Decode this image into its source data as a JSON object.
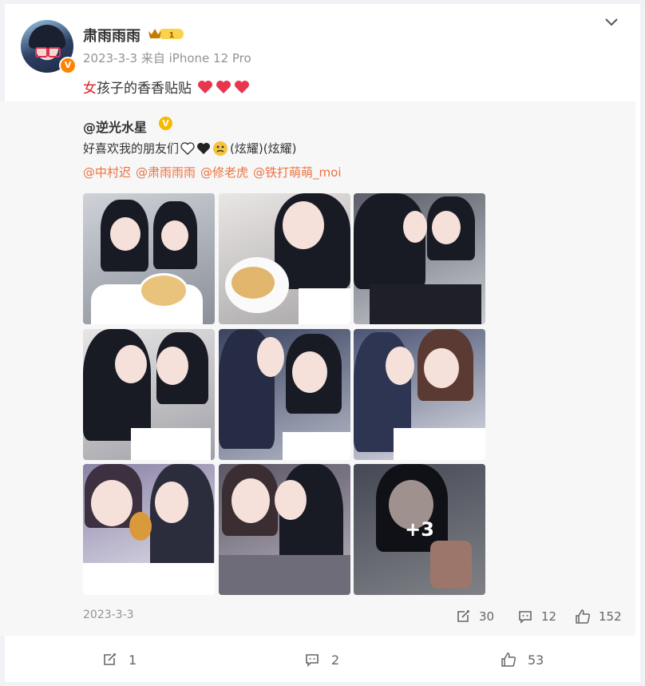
{
  "post": {
    "author": "肃雨雨雨",
    "level_badge": "1",
    "verified_badge": "V",
    "date": "2023-3-3",
    "source": "来自 iPhone 12 Pro",
    "text_highlight": "女",
    "text_rest": "孩子的香香贴贴"
  },
  "repost": {
    "author": "@逆光水星",
    "verified_badge": "V",
    "text_start": "好喜欢我的朋友们",
    "text_tail": "(炫耀)(炫耀)",
    "mentions": [
      "@中村迟",
      "@肃雨雨雨",
      "@修老虎",
      "@铁打萌萌_moi"
    ],
    "more_label": "+3",
    "date": "2023-3-3",
    "stats": {
      "shares": "30",
      "comments": "12",
      "likes": "152"
    }
  },
  "footer": {
    "shares": "1",
    "comments": "2",
    "likes": "53"
  },
  "colors": {
    "mention": "#eb7340",
    "highlight": "#e02020",
    "badge": "#ff8200"
  }
}
